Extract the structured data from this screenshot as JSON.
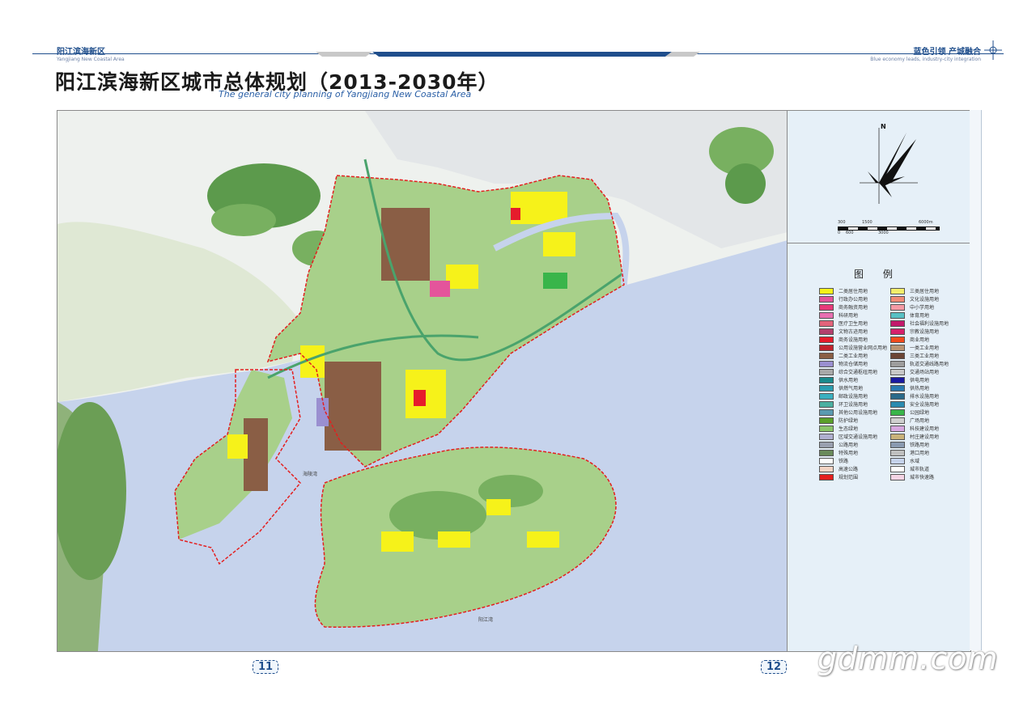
{
  "header": {
    "brand_cn": "阳江滨海新区",
    "brand_en": "Yangjiang New Coastal Area",
    "slogan_cn": "蓝色引领 产城融合",
    "slogan_en": "Blue economy leads, industry-city integration"
  },
  "page": {
    "title": "阳江滨海新区城市总体规划（2013-2030年）",
    "subtitle": "The general city planning of Yangjiang New Coastal Area"
  },
  "map": {
    "place_labels": [
      "海陵湾",
      "阳江湾"
    ],
    "north_label": "N",
    "scale_top": [
      "300",
      "1500",
      "6000m"
    ],
    "scale_bottom": [
      "0",
      "600",
      "3000"
    ]
  },
  "legend": {
    "title": "图 例",
    "items": [
      {
        "label": "二类居住用地",
        "color": "#f6f21a"
      },
      {
        "label": "三类居住用地",
        "color": "#f3ee6a"
      },
      {
        "label": "行政办公用地",
        "color": "#e4549b"
      },
      {
        "label": "文化设施用地",
        "color": "#f08a76"
      },
      {
        "label": "商务融资用地",
        "color": "#e73a7a"
      },
      {
        "label": "中小学用地",
        "color": "#f39aa5"
      },
      {
        "label": "科研用地",
        "color": "#e86fb1"
      },
      {
        "label": "体育用地",
        "color": "#57c0c4"
      },
      {
        "label": "医疗卫生用地",
        "color": "#e2637a"
      },
      {
        "label": "社会福利设施用地",
        "color": "#c2186b"
      },
      {
        "label": "文物古迹用地",
        "color": "#b3406d"
      },
      {
        "label": "宗教设施用地",
        "color": "#d6206c"
      },
      {
        "label": "商务设施用地",
        "color": "#e61c2c"
      },
      {
        "label": "商业用地",
        "color": "#f24b1c"
      },
      {
        "label": "公用设施营业网点用地",
        "color": "#c2222c"
      },
      {
        "label": "一类工业用地",
        "color": "#b99372"
      },
      {
        "label": "二类工业用地",
        "color": "#8a5e45"
      },
      {
        "label": "三类工业用地",
        "color": "#6b4535"
      },
      {
        "label": "物流仓储用地",
        "color": "#9a8fd0"
      },
      {
        "label": "轨道交通线路用地",
        "color": "#9d9d9d"
      },
      {
        "label": "综合交通枢纽用地",
        "color": "#a9a9a9"
      },
      {
        "label": "交通场站用地",
        "color": "#c8c8c8"
      },
      {
        "label": "供水用地",
        "color": "#1a8a8c"
      },
      {
        "label": "供电用地",
        "color": "#1a1aa0"
      },
      {
        "label": "供燃气用地",
        "color": "#2a9db0"
      },
      {
        "label": "供热用地",
        "color": "#2a7ab0"
      },
      {
        "label": "邮政设施用地",
        "color": "#3ab0c0"
      },
      {
        "label": "排水设施用地",
        "color": "#2a6a8a"
      },
      {
        "label": "环卫设施用地",
        "color": "#4ab0a0"
      },
      {
        "label": "安全设施用地",
        "color": "#2a8ab0"
      },
      {
        "label": "其他公用设施用地",
        "color": "#5a9ab0"
      },
      {
        "label": "公园绿地",
        "color": "#39b54a"
      },
      {
        "label": "防护绿地",
        "color": "#5aa02a"
      },
      {
        "label": "广场用地",
        "color": "#cfcfcf"
      },
      {
        "label": "生态绿地",
        "color": "#8ac56a"
      },
      {
        "label": "科技建设用地",
        "color": "#d7a7e0"
      },
      {
        "label": "区域交通设施用地",
        "color": "#b0b0d0"
      },
      {
        "label": "村庄建设用地",
        "color": "#c9b27a"
      },
      {
        "label": "公路用地",
        "color": "#9aa0b0"
      },
      {
        "label": "铁路用地",
        "color": "#8a9ab0"
      },
      {
        "label": "特殊用地",
        "color": "#6a8a5a"
      },
      {
        "label": "港口用地",
        "color": "#c0c0c0"
      },
      {
        "label": "铁路",
        "color": "#ffffff"
      },
      {
        "label": "水域",
        "color": "#c6d3ec"
      },
      {
        "label": "高速公路",
        "color": "#f4d4c4"
      },
      {
        "label": "城市轨道",
        "color": "#ffffff"
      },
      {
        "label": "规划范围",
        "color": "#e41e1e"
      },
      {
        "label": "城市快速路",
        "color": "#f4d4e4"
      }
    ]
  },
  "pages": {
    "left": "11",
    "right": "12"
  },
  "watermark": "gdmm.com",
  "colors": {
    "brand_blue": "#1f4e8c",
    "sea": "#c6d3ec",
    "land": "#a8d08a",
    "boundary": "#e41e1e"
  }
}
